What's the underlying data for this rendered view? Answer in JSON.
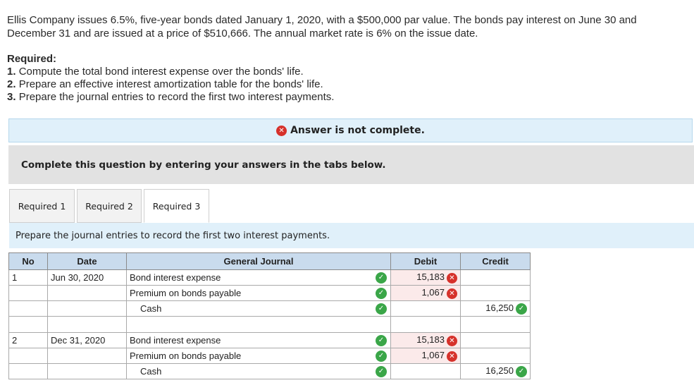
{
  "problem": {
    "text": "Ellis Company issues 6.5%, five-year bonds dated January 1, 2020, with a $500,000 par value. The bonds pay interest on June 30 and December 31 and are issued at a price of $510,666. The annual market rate is 6% on the issue date."
  },
  "required": {
    "title": "Required:",
    "items": [
      {
        "num": "1.",
        "text": "Compute the total bond interest expense over the bonds' life."
      },
      {
        "num": "2.",
        "text": "Prepare an effective interest amortization table for the bonds' life."
      },
      {
        "num": "3.",
        "text": "Prepare the journal entries to record the first two interest payments."
      }
    ]
  },
  "banner": {
    "text": "Answer is not complete.",
    "icon": "x-circle-icon"
  },
  "instruction": {
    "text": "Complete this question by entering your answers in the tabs below."
  },
  "tabs": [
    {
      "label": "Required 1",
      "active": false
    },
    {
      "label": "Required 2",
      "active": false
    },
    {
      "label": "Required 3",
      "active": true
    }
  ],
  "prepare": {
    "text": "Prepare the journal entries to record the first two interest payments."
  },
  "journal": {
    "headers": {
      "no": "No",
      "date": "Date",
      "account": "General Journal",
      "debit": "Debit",
      "credit": "Credit"
    },
    "rows": [
      {
        "no": "1",
        "date": "Jun 30, 2020",
        "account": "Bond interest expense",
        "debit": "15,183",
        "credit": ""
      },
      {
        "no": "",
        "date": "",
        "account": "Premium on bonds payable",
        "debit": "1,067",
        "credit": ""
      },
      {
        "no": "",
        "date": "",
        "account": "Cash",
        "debit": "",
        "credit": "16,250"
      },
      {
        "no": "2",
        "date": "Dec 31, 2020",
        "account": "Bond interest expense",
        "debit": "15,183",
        "credit": ""
      },
      {
        "no": "",
        "date": "",
        "account": "Premium on bonds payable",
        "debit": "1,067",
        "credit": ""
      },
      {
        "no": "",
        "date": "",
        "account": "Cash",
        "debit": "",
        "credit": "16,250"
      }
    ]
  },
  "colors": {
    "error": "#d6312b",
    "correct": "#3aa648",
    "banner_bg": "#e0f0fa",
    "header_bg": "#c9dbed"
  }
}
